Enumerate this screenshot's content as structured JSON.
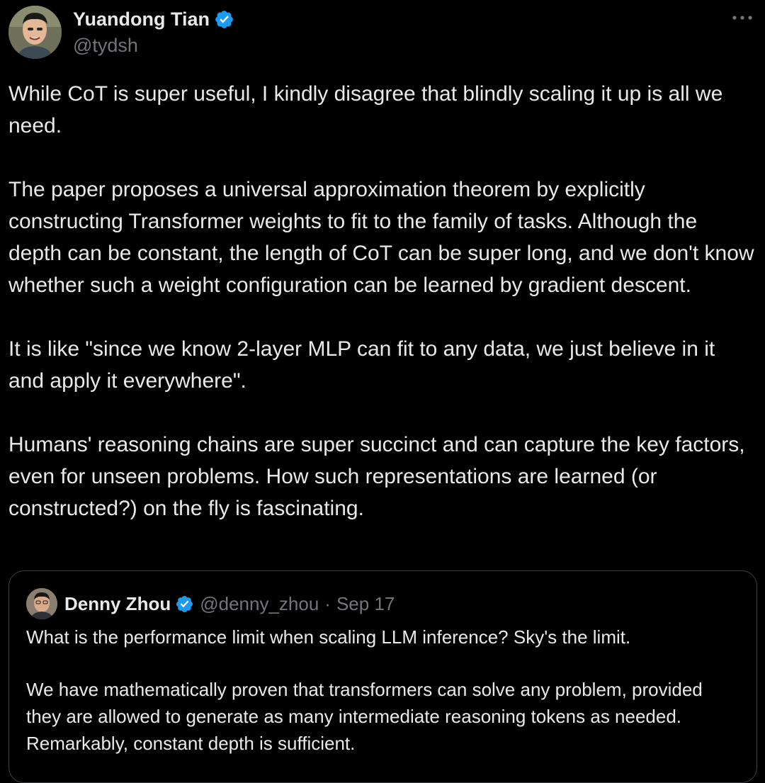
{
  "author": {
    "name": "Yuandong Tian",
    "handle": "@tydsh",
    "verified_color": "#1d9bf0"
  },
  "more_icon": "more-horizontal-icon",
  "tweet": {
    "paragraphs": [
      "While CoT is super useful, I kindly disagree that blindly scaling it up is all we need.",
      "The paper proposes a universal approximation theorem by explicitly constructing Transformer weights to fit to the family of tasks. Although the depth can be constant, the length of CoT can be super long, and we don't know whether such a weight configuration can be learned by gradient descent.",
      "It is like \"since we know 2-layer MLP can fit to any data, we just believe in it and apply it everywhere\".",
      "Humans' reasoning chains are super succinct and can capture the key factors, even for unseen problems. How such representations are learned (or constructed?) on the fly is fascinating."
    ]
  },
  "quoted_tweet": {
    "name": "Denny Zhou",
    "handle": "@denny_zhou",
    "separator": "·",
    "date": "Sep 17",
    "paragraphs": [
      "What is the performance limit when scaling LLM inference? Sky's the limit.",
      "We have mathematically proven that transformers can solve any problem, provided they are allowed to generate as many intermediate reasoning tokens as needed. Remarkably, constant depth is sufficient."
    ]
  },
  "colors": {
    "background": "#000000",
    "text": "#e7e9ea",
    "secondary": "#71767b",
    "border": "#3e4144",
    "verified": "#1d9bf0"
  }
}
